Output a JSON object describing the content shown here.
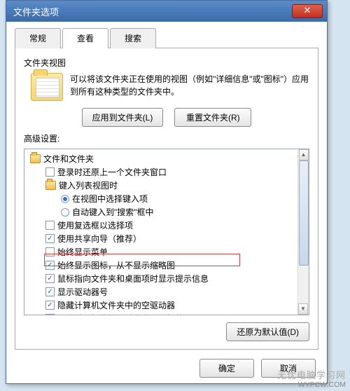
{
  "title": "文件夹选项",
  "tabs": {
    "general": "常规",
    "view": "查看",
    "search": "搜索"
  },
  "view": {
    "section": "文件夹视图",
    "desc": "可以将该文件夹正在使用的视图（例如\"详细信息\"或\"图标\"）应用到所有这种类型的文件夹中。",
    "applyBtn": "应用到文件夹(L)",
    "resetBtn": "重置文件夹(R)",
    "advanced": "高级设置:",
    "restore": "还原为默认值(D)"
  },
  "tree": {
    "n0": "文件和文件夹",
    "n1": "登录时还原上一个文件夹窗口",
    "n2": "键入列表视图时",
    "n3": "在视图中选择键入项",
    "n4": "自动键入到\"搜索\"框中",
    "n5": "使用复选框以选择项",
    "n6": "使用共享向导（推荐）",
    "n7": "始终显示菜单",
    "n8": "始终显示图标，从不显示缩略图",
    "n9": "鼠标指向文件夹和桌面项时显示提示信息",
    "n10": "显示驱动器号",
    "n11": "隐藏计算机文件夹中的空驱动器",
    "n12": "隐藏受保护的操作系统文件（推荐）"
  },
  "buttons": {
    "ok": "确定",
    "cancel": "取消"
  },
  "watermark": {
    "top": "无忧电脑学习网",
    "bottom": "WYPCW.COM"
  }
}
